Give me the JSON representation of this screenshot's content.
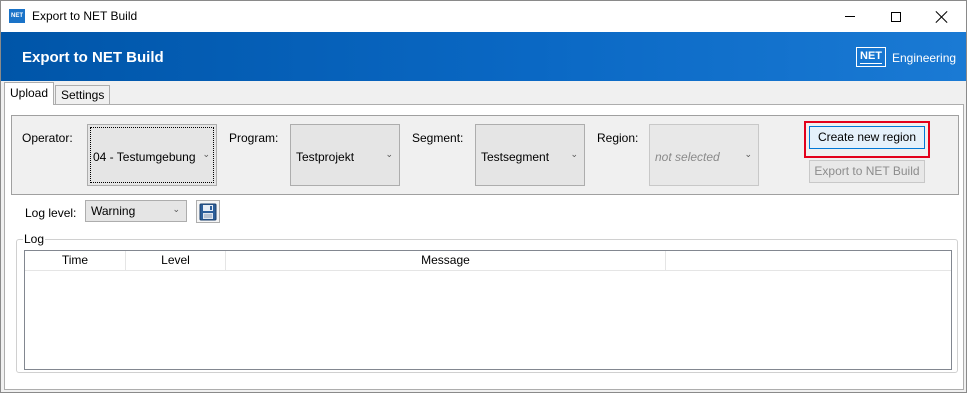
{
  "window": {
    "icon_text": "NET",
    "title": "Export to NET Build"
  },
  "banner": {
    "title": "Export to NET Build",
    "logo_box": "NET",
    "logo_text": "Engineering"
  },
  "tabs": [
    {
      "label": "Upload",
      "active": true
    },
    {
      "label": "Settings",
      "active": false
    }
  ],
  "form": {
    "operator_label": "Operator:",
    "operator_value": "04 - Testumgebung",
    "program_label": "Program:",
    "program_value": "Testprojekt",
    "segment_label": "Segment:",
    "segment_value": "Testsegment",
    "region_label": "Region:",
    "region_value": "not selected",
    "create_region_button": "Create new region",
    "export_button": "Export to NET Build"
  },
  "log_settings": {
    "label": "Log level:",
    "value": "Warning"
  },
  "log": {
    "title": "Log",
    "columns": [
      "Time",
      "Level",
      "Message",
      ""
    ]
  },
  "colors": {
    "banner": "#0a68c4",
    "highlight_outline": "#e3001b",
    "focused_button_border": "#0078d7"
  }
}
